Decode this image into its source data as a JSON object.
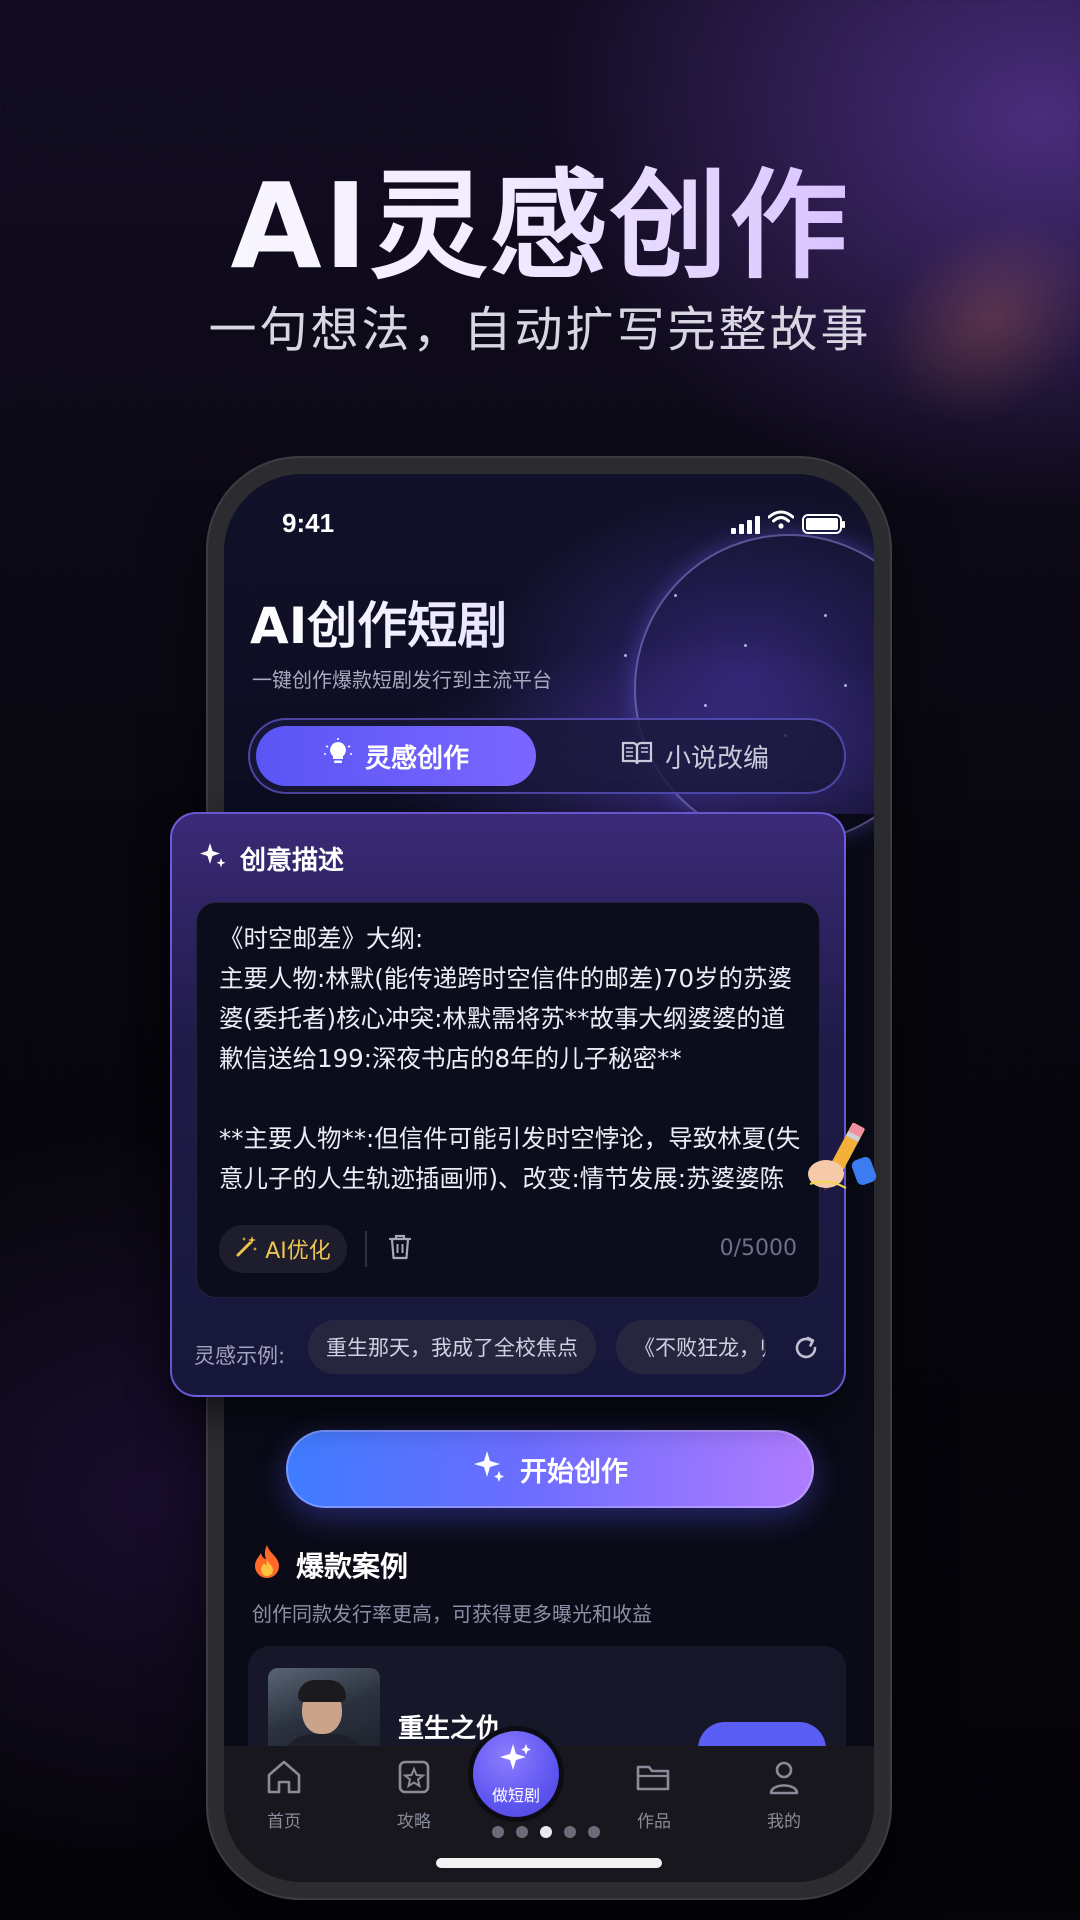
{
  "hero": {
    "title": "AI灵感创作",
    "subtitle": "一句想法，自动扩写完整故事"
  },
  "status_bar": {
    "time": "9:41"
  },
  "app": {
    "title": "AI创作短剧",
    "subtitle": "一键创作爆款短剧发行到主流平台"
  },
  "tabs": [
    {
      "label": "灵感创作",
      "icon": "lightbulb-icon",
      "active": true
    },
    {
      "label": "小说改编",
      "icon": "book-icon",
      "active": false
    }
  ],
  "creative_card": {
    "heading": "创意描述",
    "input_text": "《时空邮差》大纲:\n主要人物:林默(能传递跨时空信件的邮差)70岁的苏婆婆(委托者)核心冲突:林默需将苏**故事大纲婆婆的道歉信送给199:深夜书店的8年的儿子秘密**\n\n**主要人物**:但信件可能引发时空悖论，导致林夏(失意儿子的人生轨迹插画师)、改变:情节发展:苏婆婆陈叔(神秘书店老板)**核心冲突**儿子因当年母亲 现代都市的老城区小巷，林默du僟曹\"共今蟹",
    "ai_optimize_label": "AI优化",
    "counter": "0/5000",
    "examples_label": "灵感示例:",
    "examples": [
      "重生那天，我成了全校焦点",
      "《不败狂龙，归"
    ]
  },
  "cta": {
    "label": "开始创作"
  },
  "hot_cases": {
    "title": "爆款案例",
    "subtitle": "创作同款发行率更高，可获得更多曝光和收益",
    "items": [
      {
        "title": "重生之仇"
      }
    ]
  },
  "tabbar": {
    "items": [
      {
        "label": "首页",
        "icon": "home-icon"
      },
      {
        "label": "攻略",
        "icon": "guide-icon"
      },
      {
        "label": "做短剧",
        "icon": "sparkle-icon"
      },
      {
        "label": "作品",
        "icon": "folder-icon"
      },
      {
        "label": "我的",
        "icon": "user-icon"
      }
    ]
  },
  "pager": {
    "total": 5,
    "active_index": 2
  },
  "colors": {
    "accent": "#5a55f5",
    "ai_optimize": "#f0c44a",
    "cta_start": "#3e7cff",
    "cta_end": "#b07cff"
  }
}
